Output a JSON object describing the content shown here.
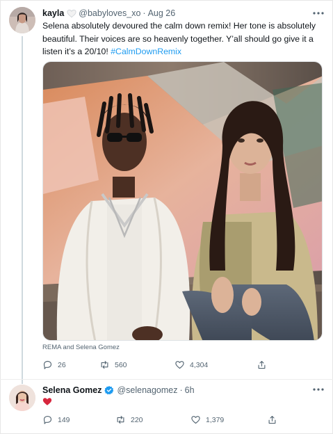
{
  "tweets": [
    {
      "display_name": "kayla",
      "handle": "@babyloves_xo",
      "separator": "·",
      "timestamp": "Aug 26",
      "name_emoji": "white-heart-emoji",
      "text": "Selena absolutely devoured the calm down remix! Her tone is absolutely beautiful. Their voices are so heavenly together. Y’all should go give it a listen it’s a 20/10! ",
      "hashtag": "#CalmDownRemix",
      "media_caption": "REMA and Selena Gomez",
      "replies": "26",
      "retweets": "560",
      "likes": "4,304"
    },
    {
      "display_name": "Selena Gomez",
      "handle": "@selenagomez",
      "separator": "·",
      "timestamp": "6h",
      "verified": true,
      "reply_emoji": "red-heart-emoji",
      "replies": "149",
      "retweets": "220",
      "likes": "1,379"
    }
  ],
  "colors": {
    "link": "#1d9bf0",
    "secondary_text": "#536471",
    "primary_text": "#0f1419",
    "thread_line": "#cfd9de",
    "heart_red": "#d7263d",
    "verified_blue": "#1d9bf0"
  },
  "icons": [
    "more-icon",
    "reply-icon",
    "retweet-icon",
    "like-icon",
    "share-icon",
    "verified-icon"
  ]
}
